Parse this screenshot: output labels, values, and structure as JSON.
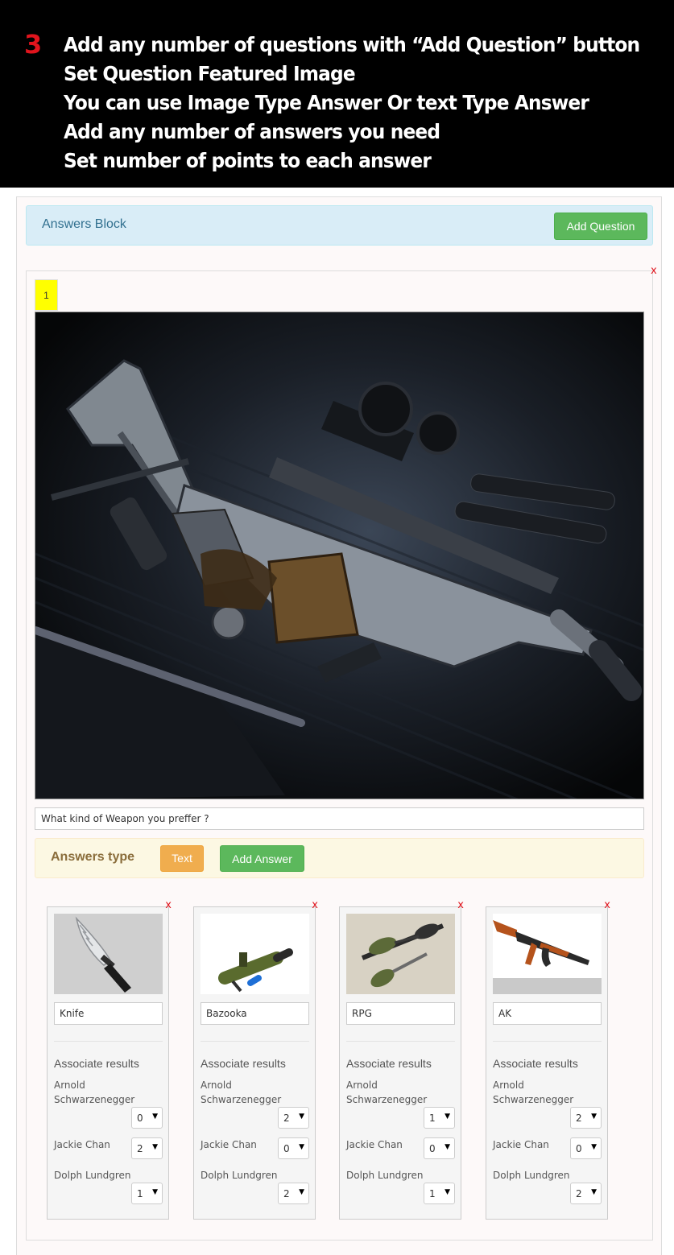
{
  "banner": {
    "step": "3",
    "lines": [
      "Add any number of questions with “Add Question” button",
      "Set Question Featured Image",
      "You can use Image Type Answer Or text Type Answer",
      "Add any number of answers you need",
      "Set number of points to each answer"
    ]
  },
  "answers_block": {
    "title": "Answers Block",
    "add_question_label": "Add Question"
  },
  "question": {
    "number": "1",
    "remove_label": "x",
    "text": "What kind of Weapon you preffer ?",
    "answers_type": {
      "title": "Answers type",
      "type_label": "Text",
      "add_answer_label": "Add Answer"
    },
    "answers": [
      {
        "name": "Knife",
        "remove_label": "x",
        "associate_title": "Associate results",
        "results": [
          {
            "name": "Arnold Schwarzenegger",
            "points": "0"
          },
          {
            "name": "Jackie Chan",
            "points": "2"
          },
          {
            "name": "Dolph Lundgren",
            "points": "1"
          }
        ]
      },
      {
        "name": "Bazooka",
        "remove_label": "x",
        "associate_title": "Associate results",
        "results": [
          {
            "name": "Arnold Schwarzenegger",
            "points": "2"
          },
          {
            "name": "Jackie Chan",
            "points": "0"
          },
          {
            "name": "Dolph Lundgren",
            "points": "2"
          }
        ]
      },
      {
        "name": "RPG",
        "remove_label": "x",
        "associate_title": "Associate results",
        "results": [
          {
            "name": "Arnold Schwarzenegger",
            "points": "1"
          },
          {
            "name": "Jackie Chan",
            "points": "0"
          },
          {
            "name": "Dolph Lundgren",
            "points": "1"
          }
        ]
      },
      {
        "name": "AK",
        "remove_label": "x",
        "associate_title": "Associate results",
        "results": [
          {
            "name": "Arnold Schwarzenegger",
            "points": "2"
          },
          {
            "name": "Jackie Chan",
            "points": "0"
          },
          {
            "name": "Dolph Lundgren",
            "points": "2"
          }
        ]
      }
    ]
  },
  "icons": {
    "select_arrow": "dropdown-arrow-icon"
  },
  "colors": {
    "accent_red": "#e0141d",
    "success": "#5cb85c",
    "warning": "#f0ad4e",
    "info_bg": "#d9edf7",
    "highlight": "#ffff00"
  }
}
